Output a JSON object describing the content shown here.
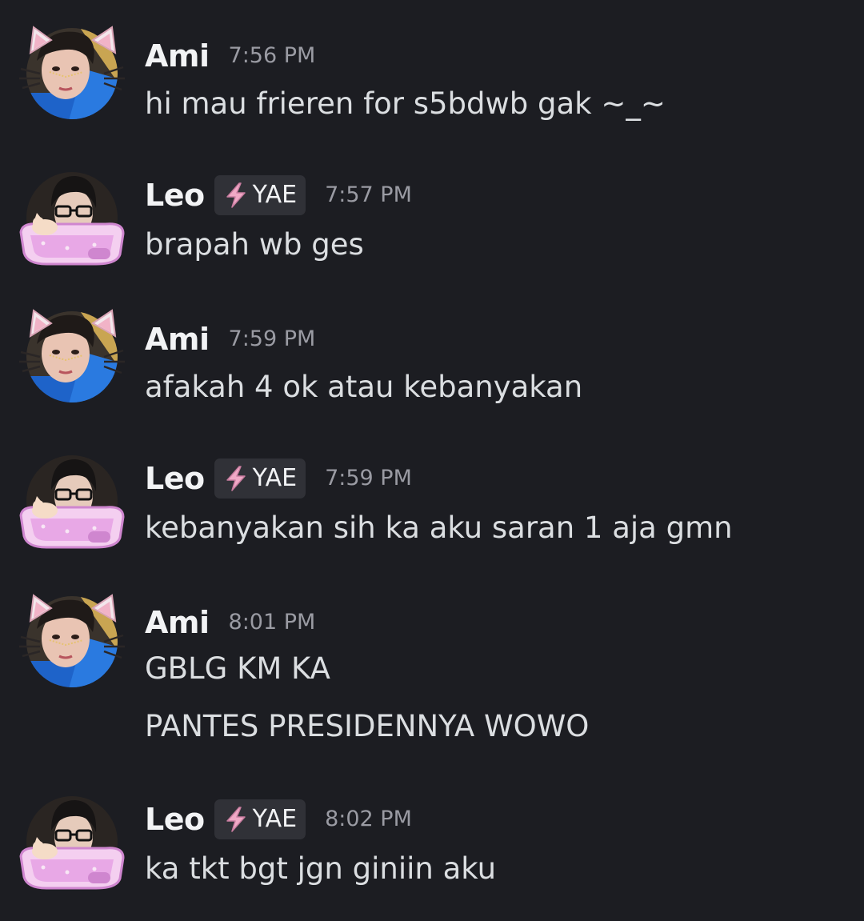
{
  "users": {
    "ami": {
      "name": "Ami"
    },
    "leo": {
      "name": "Leo",
      "tag": "YAE"
    }
  },
  "messages": [
    {
      "author": "Ami",
      "time": "7:56 PM",
      "lines": [
        "hi mau frieren for s5bdwb gak ~_~"
      ]
    },
    {
      "author": "Leo",
      "tag": "YAE",
      "time": "7:57 PM",
      "lines": [
        "brapah wb ges"
      ]
    },
    {
      "author": "Ami",
      "time": "7:59 PM",
      "lines": [
        "afakah 4 ok atau kebanyakan"
      ]
    },
    {
      "author": "Leo",
      "tag": "YAE",
      "time": "7:59 PM",
      "lines": [
        "kebanyakan sih ka aku saran 1 aja gmn"
      ]
    },
    {
      "author": "Ami",
      "time": "8:01 PM",
      "lines": [
        "GBLG KM KA",
        "PANTES PRESIDENNYA WOWO"
      ]
    },
    {
      "author": "Leo",
      "tag": "YAE",
      "time": "8:02 PM",
      "lines": [
        "ka tkt bgt jgn giniin aku"
      ]
    }
  ],
  "colors": {
    "background": "#1c1d22",
    "tag_background": "#303137",
    "tag_icon": "#f0a9c6",
    "timestamp": "#9a9ba3",
    "text": "#dbdee1"
  }
}
